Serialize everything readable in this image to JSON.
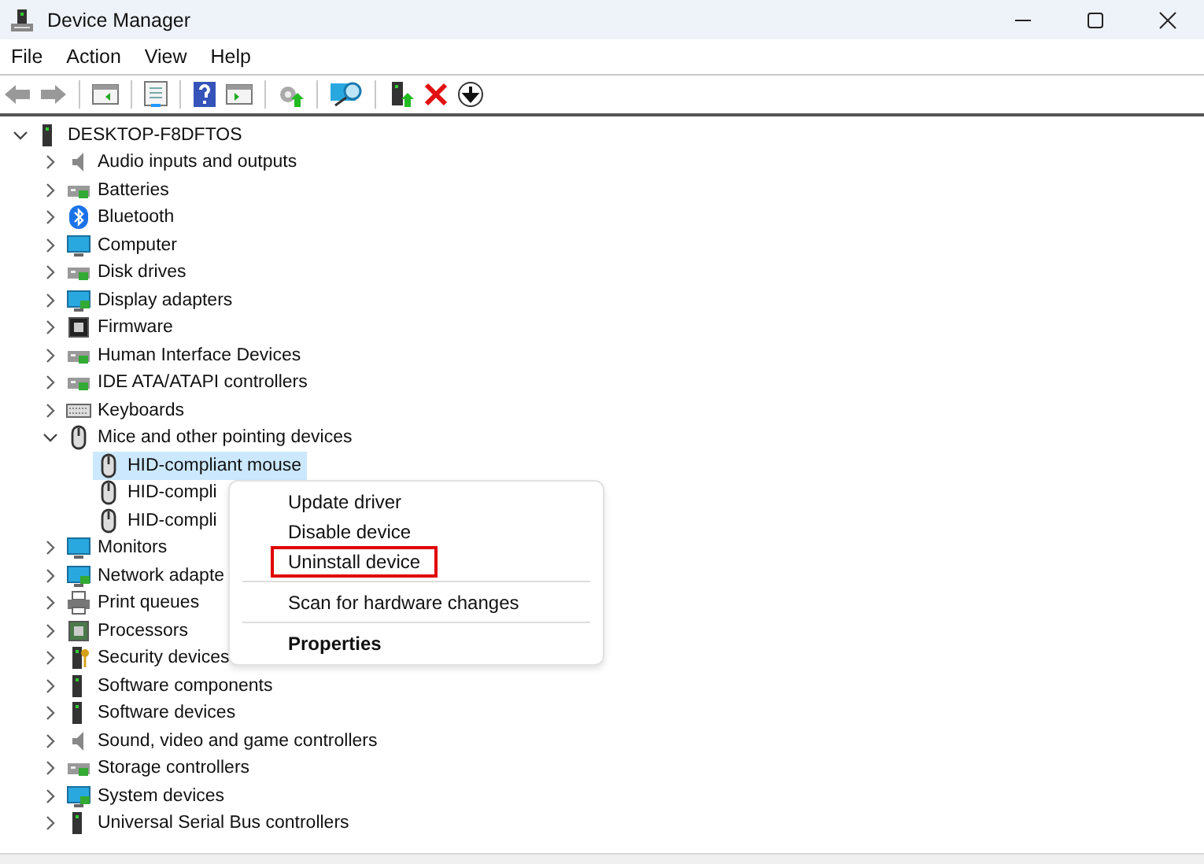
{
  "window": {
    "title": "Device Manager"
  },
  "menu": [
    "File",
    "Action",
    "View",
    "Help"
  ],
  "tree": {
    "label": "DESKTOP-F8DFTOS",
    "expanded": true,
    "selected": false,
    "children": [
      {
        "label": "Audio inputs and outputs",
        "expanded": false,
        "selected": false
      },
      {
        "label": "Batteries",
        "expanded": false,
        "selected": false
      },
      {
        "label": "Bluetooth",
        "expanded": false,
        "selected": false
      },
      {
        "label": "Computer",
        "expanded": false,
        "selected": false
      },
      {
        "label": "Disk drives",
        "expanded": false,
        "selected": false
      },
      {
        "label": "Display adapters",
        "expanded": false,
        "selected": false
      },
      {
        "label": "Firmware",
        "expanded": false,
        "selected": false
      },
      {
        "label": "Human Interface Devices",
        "expanded": false,
        "selected": false
      },
      {
        "label": "IDE ATA/ATAPI controllers",
        "expanded": false,
        "selected": false
      },
      {
        "label": "Keyboards",
        "expanded": false,
        "selected": false
      },
      {
        "label": "Mice and other pointing devices",
        "expanded": true,
        "selected": false,
        "children": [
          {
            "label": "HID-compliant mouse",
            "selected": true
          },
          {
            "label": "HID-compli",
            "selected": false
          },
          {
            "label": "HID-compli",
            "selected": false
          }
        ]
      },
      {
        "label": "Monitors",
        "expanded": false,
        "selected": false
      },
      {
        "label": "Network adapte",
        "expanded": false,
        "selected": false
      },
      {
        "label": "Print queues",
        "expanded": false,
        "selected": false
      },
      {
        "label": "Processors",
        "expanded": false,
        "selected": false
      },
      {
        "label": "Security devices",
        "expanded": false,
        "selected": false
      },
      {
        "label": "Software components",
        "expanded": false,
        "selected": false
      },
      {
        "label": "Software devices",
        "expanded": false,
        "selected": false
      },
      {
        "label": "Sound, video and game controllers",
        "expanded": false,
        "selected": false
      },
      {
        "label": "Storage controllers",
        "expanded": false,
        "selected": false
      },
      {
        "label": "System devices",
        "expanded": false,
        "selected": false
      },
      {
        "label": "Universal Serial Bus controllers",
        "expanded": false,
        "selected": false
      }
    ]
  },
  "context_menu": {
    "items": [
      {
        "label": "Update driver",
        "separator_before": false,
        "default": false,
        "outlined": false
      },
      {
        "label": "Disable device",
        "separator_before": false,
        "default": false,
        "outlined": false
      },
      {
        "label": "Uninstall device",
        "separator_before": false,
        "default": false,
        "outlined": true
      },
      {
        "label": "Scan for hardware changes",
        "separator_before": true,
        "default": false,
        "outlined": false
      },
      {
        "label": "Properties",
        "separator_before": true,
        "default": true,
        "outlined": false
      }
    ]
  }
}
